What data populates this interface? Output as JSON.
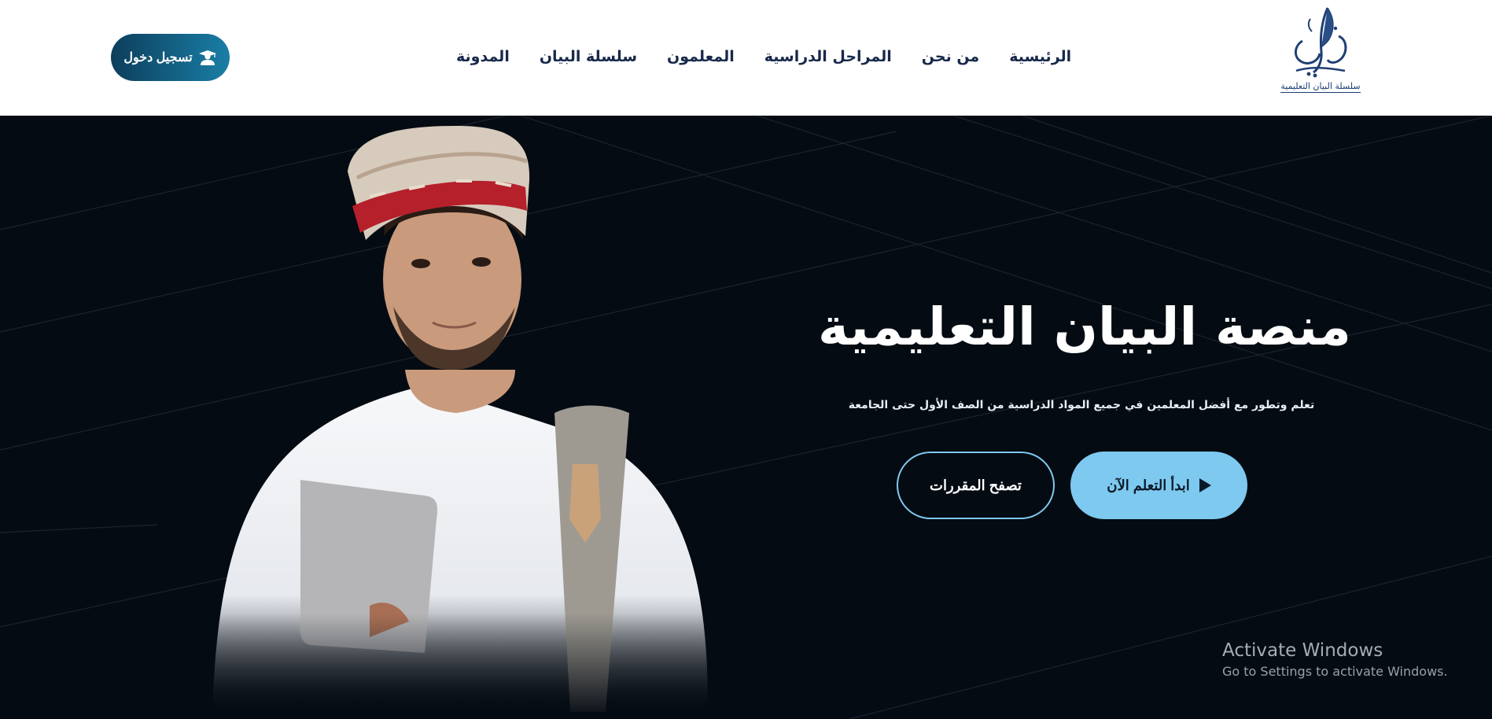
{
  "header": {
    "login_label": "تسجيل دخول",
    "logo_caption": "سلسلة البيان التعليمية",
    "nav": [
      "الرئيسية",
      "من نحن",
      "المراحل الدراسية",
      "المعلمون",
      "سلسلة البيان",
      "المدونة"
    ]
  },
  "hero": {
    "title": "منصة البيان التعليمية",
    "subtitle": "تعلم وتطور مع أفضل المعلمين في جميع المواد الدراسية من الصف الأول حتى الجامعة",
    "start_label": "ابدأ التعلم الآن",
    "browse_label": "تصفح المقررات"
  },
  "watermark": {
    "title": "Activate Windows",
    "subtitle": "Go to Settings to activate Windows."
  },
  "colors": {
    "header_bg": "#ffffff",
    "hero_bg": "#050b12",
    "accent": "#7ec9ef",
    "nav_text": "#17284a",
    "login_gradient_start": "#0d3e5c",
    "login_gradient_end": "#1a7ea6"
  },
  "icons": {
    "login": "graduate-user-icon",
    "start": "play-icon",
    "logo": "quill-calligraphy-logo"
  }
}
